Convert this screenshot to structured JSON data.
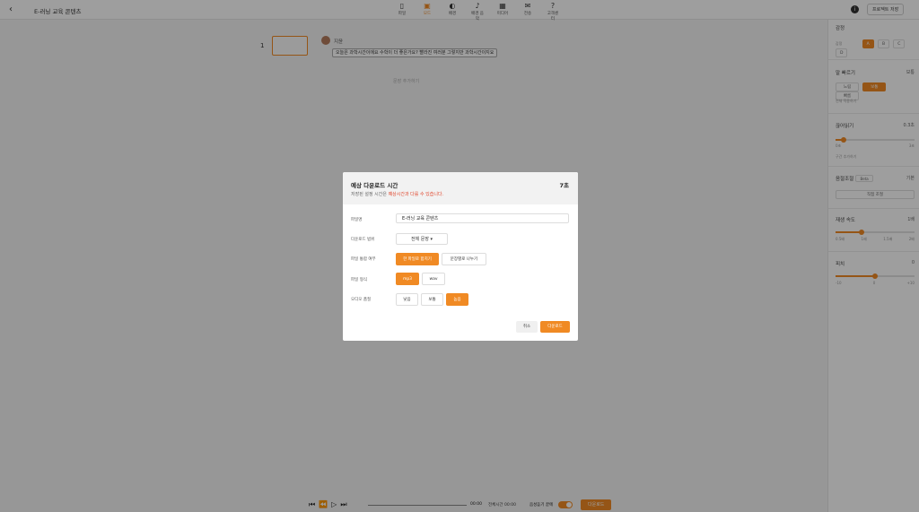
{
  "header": {
    "back_icon": "chevron-left-icon",
    "project_title": "E-러닝 교육 콘텐츠",
    "tools": [
      {
        "label": "파일",
        "icon": "file-icon",
        "glyph": "▯"
      },
      {
        "label": "모드",
        "icon": "ai-mode-icon",
        "glyph": "▣"
      },
      {
        "label": "배경",
        "icon": "palette-icon",
        "glyph": "◐"
      },
      {
        "label": "배경 음악",
        "icon": "music-icon",
        "glyph": "♪"
      },
      {
        "label": "미디어",
        "icon": "media-icon",
        "glyph": "▦"
      },
      {
        "label": "전송",
        "icon": "mail-icon",
        "glyph": "✉"
      },
      {
        "label": "고객센터",
        "icon": "help-icon",
        "glyph": "?"
      }
    ],
    "info_icon": "info-icon",
    "download_label": "프로젝트 저장"
  },
  "editor": {
    "row_number": "1",
    "speaker_name": "지윤",
    "script_text": "오늘은 과학시간이에요 수학이 더 좋은가요? 빨라진 여러분 그렇지만 과학시간이지요",
    "add_sentence": "문장 추가하기"
  },
  "right_panel": {
    "emotion": {
      "title": "감정",
      "row_label": "감정",
      "options": [
        "A",
        "B",
        "C",
        "D"
      ],
      "selected": "A"
    },
    "speed": {
      "title": "말 빠르기",
      "value": "보통",
      "options": [
        "느림",
        "보통",
        "빠름"
      ],
      "selected": "보통",
      "apply_all": "전체 적용하기"
    },
    "pause": {
      "title": "끊어읽기",
      "value": "0.3초",
      "min_label": "0초",
      "max_label": "3초",
      "fraction": 0.1,
      "apply_label": "구간 추가하기"
    },
    "pitch_tone": {
      "title": "음절조절",
      "badge": "Beta",
      "value": "기본",
      "button": "직접 조절"
    },
    "tempo": {
      "title": "재생 속도",
      "value": "1배",
      "ticks": [
        "0.5배",
        "1배",
        "1.5배",
        "2배"
      ],
      "fraction": 0.33
    },
    "pitch": {
      "title": "피치",
      "value": "0",
      "ticks": [
        "-10",
        "0",
        "+10"
      ],
      "fraction": 0.5
    }
  },
  "bottom": {
    "controls": "⏮⏪▷⏭",
    "current_time": "00:00",
    "total_time": "전체시간 00:00",
    "auto_label": "음성듣기 끝에",
    "download_label": "다운로드"
  },
  "modal": {
    "title": "예상 다운로드 시간",
    "estimate": "7초",
    "subtitle_prefix": "저장된 설정 시간은",
    "subtitle_highlight": "예상시간과 다를 수 있습니다.",
    "file_name_label": "파일명",
    "file_name_value": "E-러닝 교육 콘텐츠",
    "range_label": "다운로드 범위",
    "range_value": "전체 문장",
    "merge_label": "파일 통합 여부",
    "merge_options": [
      "한 파일로 합치기",
      "문장별로 나누기"
    ],
    "merge_selected": 0,
    "format_label": "파일 형식",
    "format_options": [
      "mp3",
      "wav"
    ],
    "format_selected": 0,
    "quality_label": "오디오 품질",
    "quality_options": [
      "낮음",
      "보통",
      "높음"
    ],
    "quality_selected": 2,
    "cancel_label": "취소",
    "download_label": "다운로드"
  },
  "colors": {
    "accent": "#f08a24",
    "warning": "#e0452b"
  }
}
